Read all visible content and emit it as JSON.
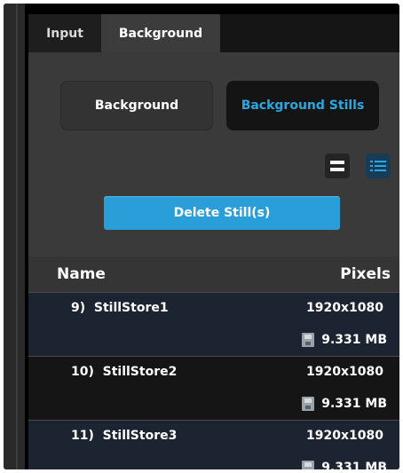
{
  "tabs": [
    {
      "label": "Input",
      "active": false
    },
    {
      "label": "Background",
      "active": true
    }
  ],
  "segment": {
    "background_label": "Background",
    "stills_label": "Background Stills",
    "selected": "Background Stills"
  },
  "view_toggle": {
    "options": [
      "compact-view-icon",
      "list-view-icon"
    ],
    "selected": "list-view-icon"
  },
  "delete_label": "Delete Still(s)",
  "table": {
    "headers": {
      "name": "Name",
      "pixels": "Pixels"
    },
    "rows": [
      {
        "name": "9)  StillStore1",
        "pixels": "1920x1080",
        "size": "9.331 MB"
      },
      {
        "name": "10)  StillStore2",
        "pixels": "1920x1080",
        "size": "9.331 MB"
      },
      {
        "name": "11)  StillStore3",
        "pixels": "1920x1080",
        "size": "9.331 MB"
      }
    ]
  },
  "colors": {
    "accent": "#2aa8e0",
    "button_blue": "#2a9ed8",
    "row_highlight": "#1b2430",
    "panel": "#3a3a3a"
  }
}
